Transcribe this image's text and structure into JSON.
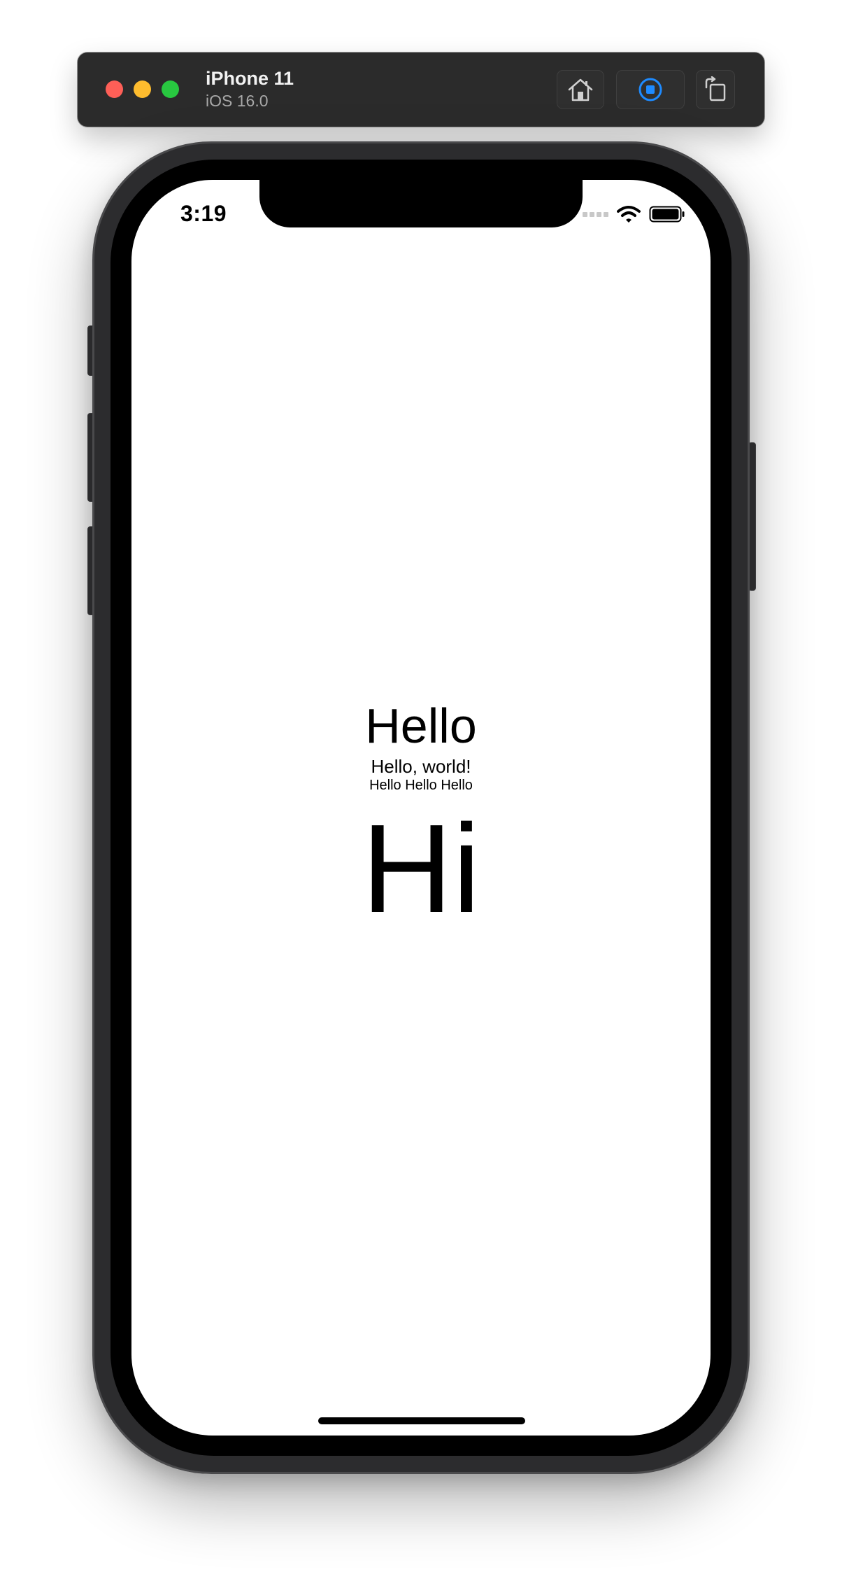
{
  "toolbar": {
    "device_name": "iPhone 11",
    "os_version": "iOS 16.0",
    "accent_color": "#1e8bff",
    "buttons": {
      "home_icon": "home-icon",
      "record_icon": "record-stop-icon",
      "rotate_icon": "rotate-icon"
    }
  },
  "status_bar": {
    "time": "3:19",
    "icons": [
      "cellular-signal-icon",
      "wifi-icon",
      "battery-icon"
    ]
  },
  "app": {
    "heading": "Hello",
    "subtitle": "Hello, world!",
    "caption": "Hello Hello Hello",
    "large_text": "Hi"
  }
}
